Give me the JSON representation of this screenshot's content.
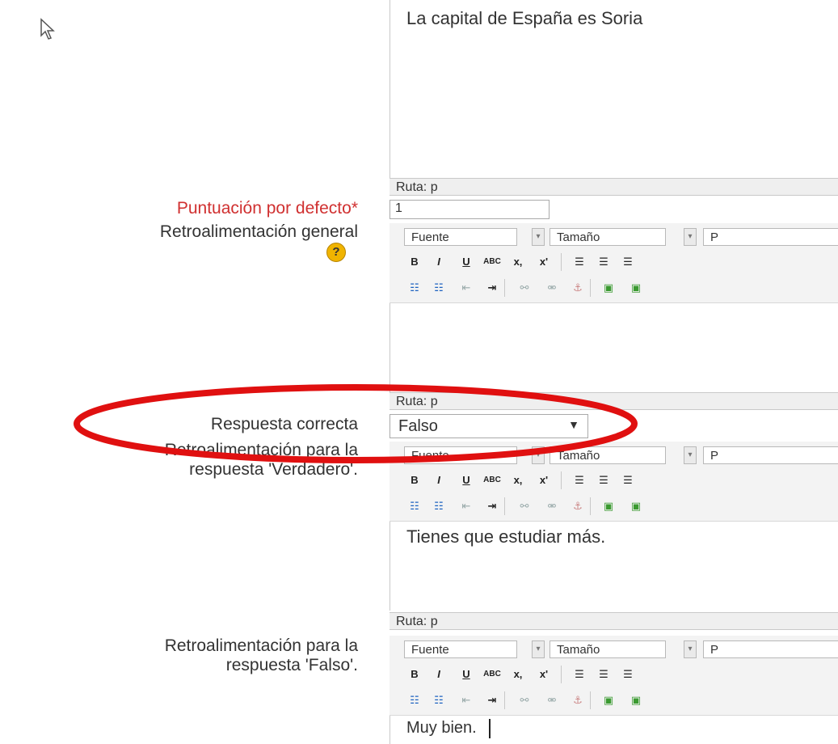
{
  "question_text": "La capital de España es Soria",
  "path_label": "Ruta: p",
  "default_mark": {
    "label": "Puntuación por defecto*",
    "value": "1"
  },
  "general_feedback": {
    "label": "Retroalimentación general",
    "content": ""
  },
  "correct_answer": {
    "label": "Respuesta correcta",
    "value": "Falso"
  },
  "feedback_true": {
    "label_line1": "Retroalimentación para la",
    "label_line2": "respuesta 'Verdadero'.",
    "content": "Tienes que estudiar más."
  },
  "feedback_false": {
    "label_line1": "Retroalimentación para la",
    "label_line2": "respuesta 'Falso'.",
    "content": "Muy bien."
  },
  "toolbar": {
    "font_label": "Fuente",
    "size_label": "Tamaño",
    "paragraph_label": "P",
    "bold": "B",
    "italic": "I",
    "underline": "U",
    "strike": "ABC",
    "subscript": "x,",
    "superscript": "x'"
  },
  "colors": {
    "required_label": "#d03030",
    "annotation": "#e01010",
    "help_icon": "#f0b400"
  }
}
